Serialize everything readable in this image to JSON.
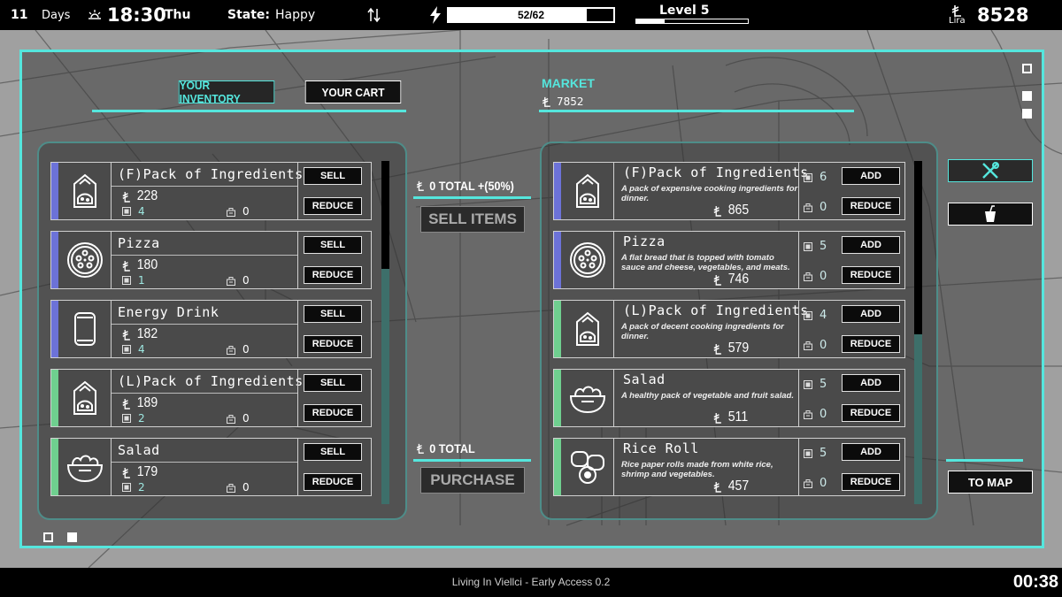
{
  "hud": {
    "days_num": "11",
    "days_label": "Days",
    "time": "18:30",
    "weekday": "Thu",
    "state_label": "State:",
    "state_value": "Happy",
    "energy_text": "52/62",
    "energy_fraction": 0.839,
    "level_text": "Level  5",
    "level_fraction": 0.25,
    "lira_label": "Lira",
    "lira_amount": "8528"
  },
  "tabs": {
    "inventory": "YOUR INVENTORY",
    "cart": "YOUR CART"
  },
  "market": {
    "label": "MARKET",
    "amount": "7852"
  },
  "inventory": [
    {
      "name": "(F)Pack of Ingredients",
      "price": "228",
      "stock": "4",
      "cart": "0",
      "stripe": "#6c72d8",
      "icon": "ingredients-bag-icon",
      "sell": "SELL",
      "reduce": "REDUCE"
    },
    {
      "name": "Pizza",
      "price": "180",
      "stock": "1",
      "cart": "0",
      "stripe": "#6c72d8",
      "icon": "pizza-icon",
      "sell": "SELL",
      "reduce": "REDUCE"
    },
    {
      "name": "Energy Drink",
      "price": "182",
      "stock": "4",
      "cart": "0",
      "stripe": "#6c72d8",
      "icon": "can-icon",
      "sell": "SELL",
      "reduce": "REDUCE"
    },
    {
      "name": "(L)Pack of Ingredients",
      "price": "189",
      "stock": "2",
      "cart": "0",
      "stripe": "#6fcf8f",
      "icon": "ingredients-bag-icon",
      "sell": "SELL",
      "reduce": "REDUCE"
    },
    {
      "name": "Salad",
      "price": "179",
      "stock": "2",
      "cart": "0",
      "stripe": "#6fcf8f",
      "icon": "salad-bowl-icon",
      "sell": "SELL",
      "reduce": "REDUCE"
    }
  ],
  "market_items": [
    {
      "name": "(F)Pack of Ingredients",
      "desc": "A pack of expensive cooking ingredients for dinner.",
      "price": "865",
      "stock": "6",
      "cart": "0",
      "stripe": "#6c72d8",
      "icon": "ingredients-bag-icon",
      "add": "ADD",
      "reduce": "REDUCE"
    },
    {
      "name": "Pizza",
      "desc": "A flat bread that is topped with tomato sauce and cheese, vegetables, and meats.",
      "price": "746",
      "stock": "5",
      "cart": "0",
      "stripe": "#6c72d8",
      "icon": "pizza-icon",
      "add": "ADD",
      "reduce": "REDUCE"
    },
    {
      "name": "(L)Pack of Ingredients",
      "desc": "A pack of decent cooking ingredients for dinner.",
      "price": "579",
      "stock": "4",
      "cart": "0",
      "stripe": "#6fcf8f",
      "icon": "ingredients-bag-icon",
      "add": "ADD",
      "reduce": "REDUCE"
    },
    {
      "name": "Salad",
      "desc": "A healthy pack of vegetable and fruit salad.",
      "price": "511",
      "stock": "5",
      "cart": "0",
      "stripe": "#6fcf8f",
      "icon": "salad-bowl-icon",
      "add": "ADD",
      "reduce": "REDUCE"
    },
    {
      "name": "Rice Roll",
      "desc": "Rice paper rolls made from white rice, shrimp and vegetables.",
      "price": "457",
      "stock": "5",
      "cart": "0",
      "stripe": "#6fcf8f",
      "icon": "rice-roll-icon",
      "add": "ADD",
      "reduce": "REDUCE"
    }
  ],
  "sell_panel": {
    "total": "0 TOTAL +(50%)",
    "button": "SELL ITEMS"
  },
  "purchase_panel": {
    "total": "0 TOTAL",
    "button": "PURCHASE"
  },
  "side": {
    "to_map": "TO MAP",
    "food_icon": "utensils-icon",
    "drink_icon": "drink-cup-icon"
  },
  "footer": {
    "title": "Living In Viellci - Early Access 0.2",
    "clock": "00:38"
  },
  "colors": {
    "accent": "#55e6dd",
    "stripe_premium": "#6c72d8",
    "stripe_standard": "#6fcf8f"
  }
}
